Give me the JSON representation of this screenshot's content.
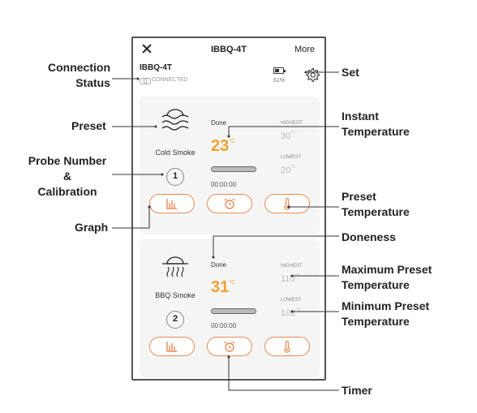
{
  "header": {
    "title": "IBBQ-4T",
    "more_label": "More"
  },
  "device": {
    "name": "IBBQ-4T",
    "connection_status": "CONNECTED",
    "battery_percent": "61%",
    "battery_level": 0.61
  },
  "probes": [
    {
      "preset_name": "Cold Smoke",
      "probe_number": "1",
      "status": "Done",
      "temperature": "23",
      "temp_unit": "°C",
      "highest_label": "HIGHEST",
      "highest_value": "30",
      "lowest_label": "LOWEST",
      "lowest_value": "20",
      "timer": "00:00:00"
    },
    {
      "preset_name": "BBQ Smoke",
      "probe_number": "2",
      "status": "Done",
      "temperature": "31",
      "temp_unit": "°C",
      "highest_label": "HIGHEST",
      "highest_value": "110",
      "lowest_label": "LOWEST",
      "lowest_value": "102",
      "timer": "00:00:00"
    }
  ],
  "annotations": {
    "connection_status_1": "Connection",
    "connection_status_2": "Status",
    "set": "Set",
    "preset": "Preset",
    "instant_temp_1": "Instant",
    "instant_temp_2": "Temperature",
    "probe_number_1": "Probe Number",
    "probe_number_2": "&",
    "probe_number_3": "Calibration",
    "preset_temp_1": "Preset",
    "preset_temp_2": "Temperature",
    "graph": "Graph",
    "doneness": "Doneness",
    "max_preset_1": "Maximum Preset",
    "max_preset_2": "Temperature",
    "min_preset_1": "Minimum Preset",
    "min_preset_2": "Temperature",
    "timer": "Timer"
  },
  "colors": {
    "accent": "#e88b55",
    "temperature": "#f0a030",
    "frame": "#555555"
  },
  "icons": [
    "close-icon",
    "battery-icon",
    "gear-icon",
    "link-icon",
    "cold-smoke-icon",
    "bbq-smoke-icon",
    "graph-icon",
    "alarm-clock-icon",
    "thermometer-icon"
  ]
}
